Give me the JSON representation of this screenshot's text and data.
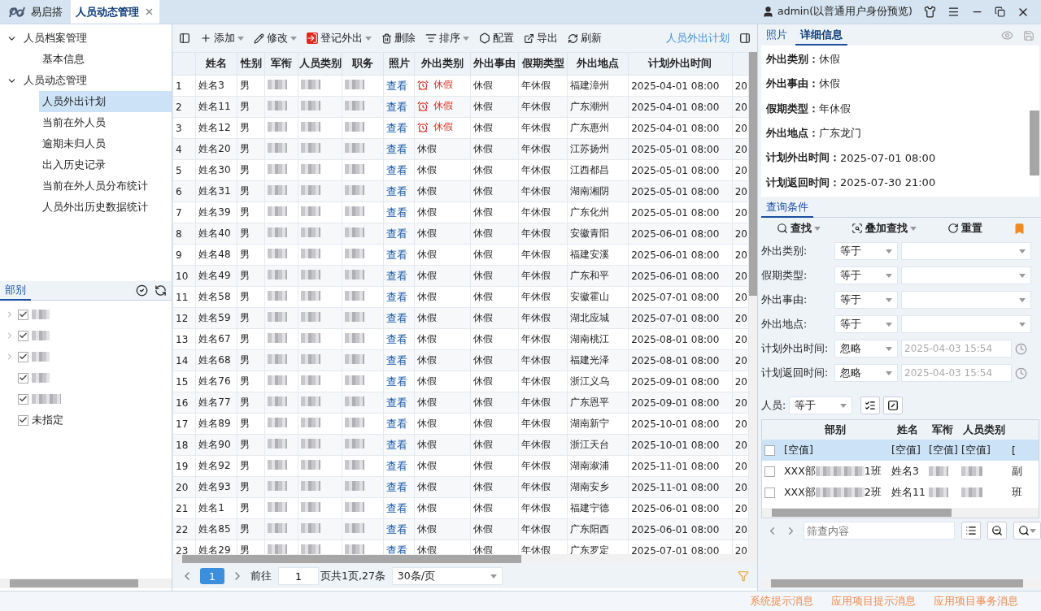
{
  "topbar": {
    "app": "易启搭",
    "tabs": [
      {
        "label": "人员动态管理",
        "selected": true
      }
    ],
    "user": "admin(以普通用户身份预览)"
  },
  "nav": [
    {
      "label": "人员档案管理",
      "expanded": true,
      "selected": false,
      "children": [
        {
          "label": "基本信息",
          "selected": false
        }
      ]
    },
    {
      "label": "人员动态管理",
      "expanded": true,
      "selected": false,
      "children": [
        {
          "label": "人员外出计划",
          "selected": true
        },
        {
          "label": "当前在外人员",
          "selected": false
        },
        {
          "label": "逾期未归人员",
          "selected": false
        },
        {
          "label": "出入历史记录",
          "selected": false
        },
        {
          "label": "当前在外人员分布统计",
          "selected": false
        },
        {
          "label": "人员外出历史数据统计",
          "selected": false
        }
      ]
    }
  ],
  "dept_panel": {
    "tab": "部别",
    "items": [
      {
        "kind": "redacted",
        "expandable": true,
        "checked": true
      },
      {
        "kind": "redacted",
        "expandable": true,
        "checked": true
      },
      {
        "kind": "redacted",
        "expandable": true,
        "checked": true
      },
      {
        "kind": "redacted",
        "expandable": false,
        "checked": true
      },
      {
        "kind": "redacted",
        "expandable": false,
        "checked": true
      },
      {
        "kind": "text",
        "label": "未指定",
        "expandable": false,
        "checked": true
      }
    ]
  },
  "toolbar": {
    "items": [
      {
        "label": "添加",
        "menu": true
      },
      {
        "label": "修改",
        "menu": true
      },
      {
        "label": "登记外出",
        "menu": true
      },
      {
        "label": "删除",
        "menu": false
      },
      {
        "label": "排序",
        "menu": true
      },
      {
        "label": "配置",
        "menu": false
      },
      {
        "label": "导出",
        "menu": false
      },
      {
        "label": "刷新",
        "menu": false
      }
    ],
    "title": "人员外出计划"
  },
  "table": {
    "columns": [
      {
        "label": "姓名",
        "kind": "name"
      },
      {
        "label": "性别",
        "kind": "gender"
      },
      {
        "label": "军衔",
        "kind": "redacted"
      },
      {
        "label": "人员类别",
        "kind": "redacted"
      },
      {
        "label": "职务",
        "kind": "redacted"
      },
      {
        "label": "照片",
        "kind": "photo"
      },
      {
        "label": "外出类别",
        "kind": "category"
      },
      {
        "label": "外出事由",
        "kind": "reason"
      },
      {
        "label": "假期类型",
        "kind": "leave_type"
      },
      {
        "label": "外出地点",
        "kind": "place"
      },
      {
        "label": "计划外出时间",
        "kind": "planned_out"
      },
      {
        "kind": "column_13"
      }
    ],
    "rows": [
      {
        "no": "1",
        "name": "姓名3",
        "gender": "男",
        "photo": "查看",
        "category": "休假",
        "alert": true,
        "reason": "休假",
        "leave_type": "年休假",
        "place": "福建漳州",
        "planned_out": "2025-04-01 08:00",
        "column_13": "20"
      },
      {
        "no": "2",
        "name": "姓名11",
        "gender": "男",
        "photo": "查看",
        "category": "休假",
        "alert": true,
        "reason": "休假",
        "leave_type": "年休假",
        "place": "广东潮州",
        "planned_out": "2025-04-01 08:00",
        "column_13": "20"
      },
      {
        "no": "3",
        "name": "姓名12",
        "gender": "男",
        "photo": "查看",
        "category": "休假",
        "alert": true,
        "reason": "休假",
        "leave_type": "年休假",
        "place": "广东惠州",
        "planned_out": "2025-04-01 08:00",
        "column_13": "20"
      },
      {
        "no": "4",
        "name": "姓名20",
        "gender": "男",
        "photo": "查看",
        "category": "休假",
        "alert": false,
        "reason": "休假",
        "leave_type": "年休假",
        "place": "江苏扬州",
        "planned_out": "2025-05-01 08:00",
        "column_13": "20"
      },
      {
        "no": "5",
        "name": "姓名30",
        "gender": "男",
        "photo": "查看",
        "category": "休假",
        "alert": false,
        "reason": "休假",
        "leave_type": "年休假",
        "place": "江西都昌",
        "planned_out": "2025-05-01 08:00",
        "column_13": "20"
      },
      {
        "no": "6",
        "name": "姓名31",
        "gender": "男",
        "photo": "查看",
        "category": "休假",
        "alert": false,
        "reason": "休假",
        "leave_type": "年休假",
        "place": "湖南湘阴",
        "planned_out": "2025-05-01 08:00",
        "column_13": "20"
      },
      {
        "no": "7",
        "name": "姓名39",
        "gender": "男",
        "photo": "查看",
        "category": "休假",
        "alert": false,
        "reason": "休假",
        "leave_type": "年休假",
        "place": "广东化州",
        "planned_out": "2025-05-01 08:00",
        "column_13": "20"
      },
      {
        "no": "8",
        "name": "姓名40",
        "gender": "男",
        "photo": "查看",
        "category": "休假",
        "alert": false,
        "reason": "休假",
        "leave_type": "年休假",
        "place": "安徽青阳",
        "planned_out": "2025-06-01 08:00",
        "column_13": "20"
      },
      {
        "no": "9",
        "name": "姓名48",
        "gender": "男",
        "photo": "查看",
        "category": "休假",
        "alert": false,
        "reason": "休假",
        "leave_type": "年休假",
        "place": "福建安溪",
        "planned_out": "2025-06-01 08:00",
        "column_13": "20"
      },
      {
        "no": "10",
        "name": "姓名49",
        "gender": "男",
        "photo": "查看",
        "category": "休假",
        "alert": false,
        "reason": "休假",
        "leave_type": "年休假",
        "place": "广东和平",
        "planned_out": "2025-06-01 08:00",
        "column_13": "20"
      },
      {
        "no": "11",
        "name": "姓名58",
        "gender": "男",
        "photo": "查看",
        "category": "休假",
        "alert": false,
        "reason": "休假",
        "leave_type": "年休假",
        "place": "安徽霍山",
        "planned_out": "2025-07-01 08:00",
        "column_13": "20"
      },
      {
        "no": "12",
        "name": "姓名59",
        "gender": "男",
        "photo": "查看",
        "category": "休假",
        "alert": false,
        "reason": "休假",
        "leave_type": "年休假",
        "place": "湖北应城",
        "planned_out": "2025-07-01 08:00",
        "column_13": "20"
      },
      {
        "no": "13",
        "name": "姓名67",
        "gender": "男",
        "photo": "查看",
        "category": "休假",
        "alert": false,
        "reason": "休假",
        "leave_type": "年休假",
        "place": "湖南桃江",
        "planned_out": "2025-08-01 08:00",
        "column_13": "20"
      },
      {
        "no": "14",
        "name": "姓名68",
        "gender": "男",
        "photo": "查看",
        "category": "休假",
        "alert": false,
        "reason": "休假",
        "leave_type": "年休假",
        "place": "福建光泽",
        "planned_out": "2025-08-01 08:00",
        "column_13": "20"
      },
      {
        "no": "15",
        "name": "姓名76",
        "gender": "男",
        "photo": "查看",
        "category": "休假",
        "alert": false,
        "reason": "休假",
        "leave_type": "年休假",
        "place": "浙江义乌",
        "planned_out": "2025-09-01 08:00",
        "column_13": "20"
      },
      {
        "no": "16",
        "name": "姓名77",
        "gender": "男",
        "photo": "查看",
        "category": "休假",
        "alert": false,
        "reason": "休假",
        "leave_type": "年休假",
        "place": "广东恩平",
        "planned_out": "2025-09-01 08:00",
        "column_13": "20"
      },
      {
        "no": "17",
        "name": "姓名89",
        "gender": "男",
        "photo": "查看",
        "category": "休假",
        "alert": false,
        "reason": "休假",
        "leave_type": "年休假",
        "place": "湖南新宁",
        "planned_out": "2025-10-01 08:00",
        "column_13": "20"
      },
      {
        "no": "18",
        "name": "姓名90",
        "gender": "男",
        "photo": "查看",
        "category": "休假",
        "alert": false,
        "reason": "休假",
        "leave_type": "年休假",
        "place": "浙江天台",
        "planned_out": "2025-10-01 08:00",
        "column_13": "20"
      },
      {
        "no": "19",
        "name": "姓名92",
        "gender": "男",
        "photo": "查看",
        "category": "休假",
        "alert": false,
        "reason": "休假",
        "leave_type": "年休假",
        "place": "湖南溆浦",
        "planned_out": "2025-11-01 08:00",
        "column_13": "20"
      },
      {
        "no": "20",
        "name": "姓名93",
        "gender": "男",
        "photo": "查看",
        "category": "休假",
        "alert": false,
        "reason": "休假",
        "leave_type": "年休假",
        "place": "湖南安乡",
        "planned_out": "2025-11-01 08:00",
        "column_13": "20"
      },
      {
        "no": "21",
        "name": "姓名1",
        "gender": "男",
        "photo": "查看",
        "category": "休假",
        "alert": false,
        "reason": "休假",
        "leave_type": "年休假",
        "place": "福建宁德",
        "planned_out": "2025-06-01 08:00",
        "column_13": "20"
      },
      {
        "no": "22",
        "name": "姓名85",
        "gender": "男",
        "photo": "查看",
        "category": "休假",
        "alert": false,
        "reason": "休假",
        "leave_type": "年休假",
        "place": "广东阳西",
        "planned_out": "2025-06-01 08:00",
        "column_13": "20"
      },
      {
        "no": "23",
        "name": "姓名29",
        "gender": "男",
        "photo": "查看",
        "category": "休假",
        "alert": false,
        "reason": "休假",
        "leave_type": "年休假",
        "place": "广东罗定",
        "planned_out": "2025-07-01 08:00",
        "column_13": "20"
      }
    ]
  },
  "pagination": {
    "pages": [
      {
        "label": "1",
        "selected": true
      }
    ],
    "goto_label": "前往",
    "goto_value": "1",
    "summary": "页共1页,27条",
    "page_size": "30条/页"
  },
  "detail": {
    "tabs": [
      {
        "label": "照片",
        "selected": false
      },
      {
        "label": "详细信息",
        "selected": true
      }
    ],
    "fields": [
      {
        "label": "外出类别：",
        "value": "休假"
      },
      {
        "label": "外出事由：",
        "value": "休假"
      },
      {
        "label": "假期类型：",
        "value": "年休假"
      },
      {
        "label": "外出地点：",
        "value": "广东龙门"
      },
      {
        "label": "计划外出时间：",
        "value": "2025-07-01 08:00"
      },
      {
        "label": "计划返回时间：",
        "value": "2025-07-30 21:00"
      }
    ]
  },
  "query": {
    "tab": "查询条件",
    "actions": [
      {
        "label": "查找",
        "menu": true
      },
      {
        "label": "叠加查找",
        "menu": true
      },
      {
        "label": "重置",
        "menu": false
      }
    ],
    "filters": [
      {
        "label": "外出类别:",
        "operator": "等于",
        "kind": "select"
      },
      {
        "label": "假期类型:",
        "operator": "等于",
        "kind": "select"
      },
      {
        "label": "外出事由:",
        "operator": "等于",
        "kind": "select"
      },
      {
        "label": "外出地点:",
        "operator": "等于",
        "kind": "select"
      },
      {
        "label": "计划外出时间:",
        "operator": "忽略",
        "kind": "datetime",
        "placeholder": "2025-04-03 15:54"
      },
      {
        "label": "计划返回时间:",
        "operator": "忽略",
        "kind": "datetime",
        "placeholder": "2025-04-03 15:54"
      }
    ],
    "person": {
      "label": "人员:",
      "operator": "等于"
    },
    "grid": {
      "columns": [
        "部别",
        "姓名",
        "军衔",
        "人员类别"
      ],
      "rows": [
        {
          "kind": "empty",
          "selected": true,
          "checked": false,
          "dept": "[空值]",
          "name": "[空值]",
          "rank": "[空值]",
          "type": "[空值]",
          "column_5": "["
        },
        {
          "kind": "person",
          "selected": false,
          "checked": false,
          "dept_prefix": "XXX部",
          "dept_suffix": "1班",
          "name": "姓名3",
          "column_5": "副"
        },
        {
          "kind": "person",
          "selected": false,
          "checked": false,
          "dept_prefix": "XXX部",
          "dept_suffix": "2班",
          "name": "姓名11",
          "column_5": "班"
        }
      ]
    },
    "filter_placeholder": "筛查内容"
  },
  "status_bar": [
    "系统提示消息",
    "应用项目提示消息",
    "应用项目事务消息"
  ]
}
